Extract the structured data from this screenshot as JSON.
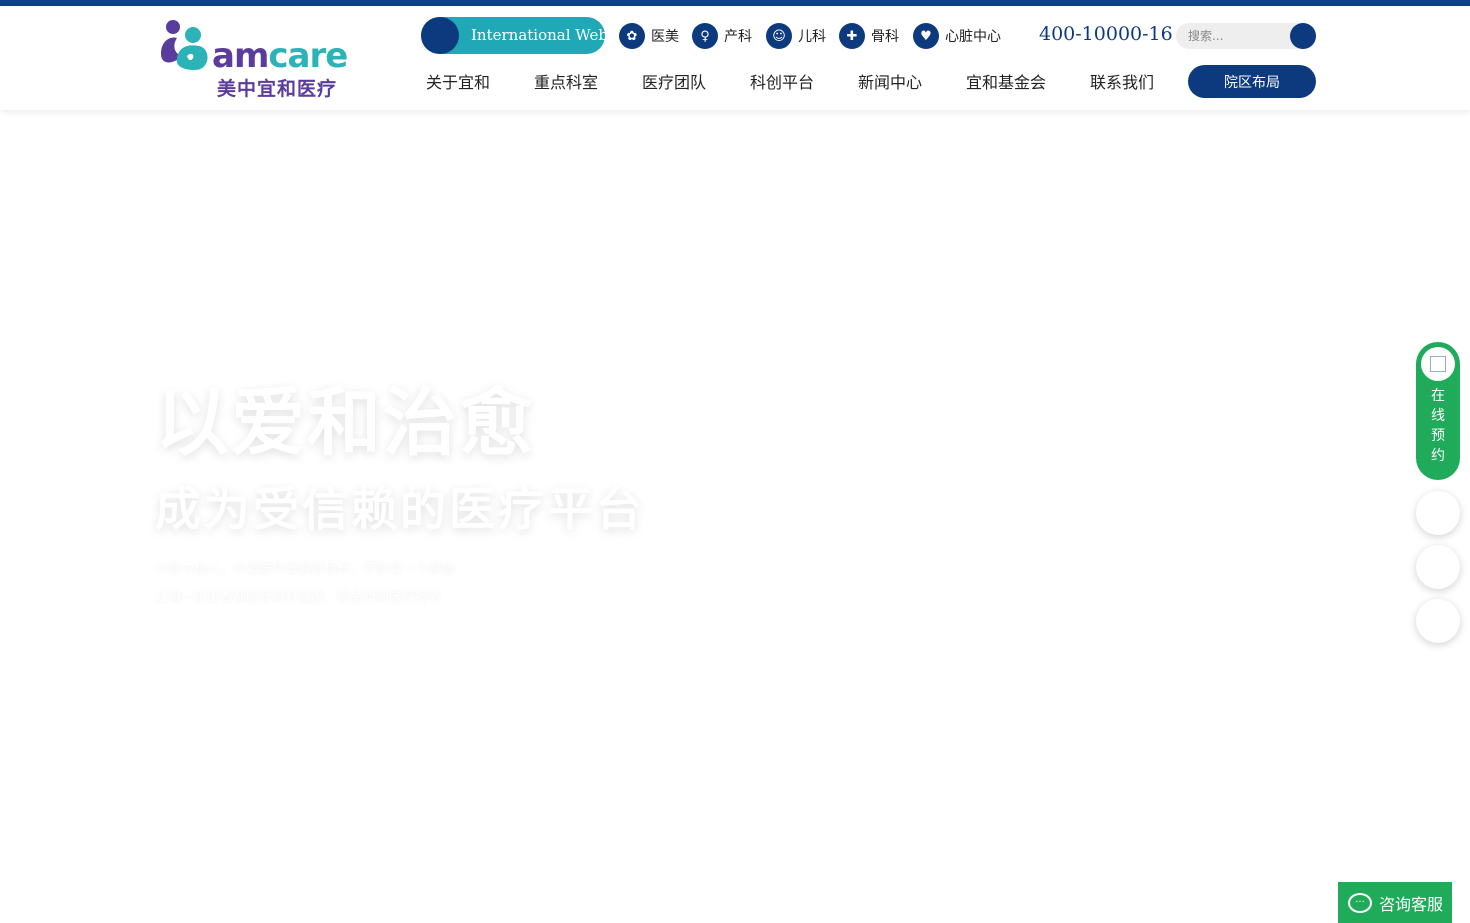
{
  "brand": {
    "logo_en_am": "am",
    "logo_en_care": "care",
    "logo_cn": "美中宜和医疗",
    "accent_dark": "#0d3a7e",
    "accent_teal": "#20a8b6",
    "accent_green": "#1fab5a"
  },
  "topbar": {
    "international_label": "International Web",
    "specialties": [
      {
        "label": "医美",
        "icon": "aesthetics-icon"
      },
      {
        "label": "产科",
        "icon": "obstetrics-icon"
      },
      {
        "label": "儿科",
        "icon": "pediatrics-icon"
      },
      {
        "label": "骨科",
        "icon": "orthopedics-icon"
      },
      {
        "label": "心脏中心",
        "icon": "heart-center-icon"
      }
    ],
    "phone": "400-10000-16",
    "search_placeholder": "搜索..."
  },
  "nav": {
    "items": [
      "关于宜和",
      "重点科室",
      "医疗团队",
      "科创平台",
      "新闻中心",
      "宜和基金会",
      "联系我们"
    ],
    "campus_button": "院区布局"
  },
  "hero": {
    "title": "以爱和治愈",
    "subtitle": "成为受信赖的医疗平台",
    "desc_line1": "以爱为核心，打造医疗服务新标杆，守护每一个家庭",
    "desc_line2": "让每一位患者都能获得有温度、高品质的医疗服务"
  },
  "side": {
    "booking_chars": [
      "在",
      "线",
      "预",
      "约"
    ]
  },
  "chat": {
    "label": "咨询客服"
  }
}
